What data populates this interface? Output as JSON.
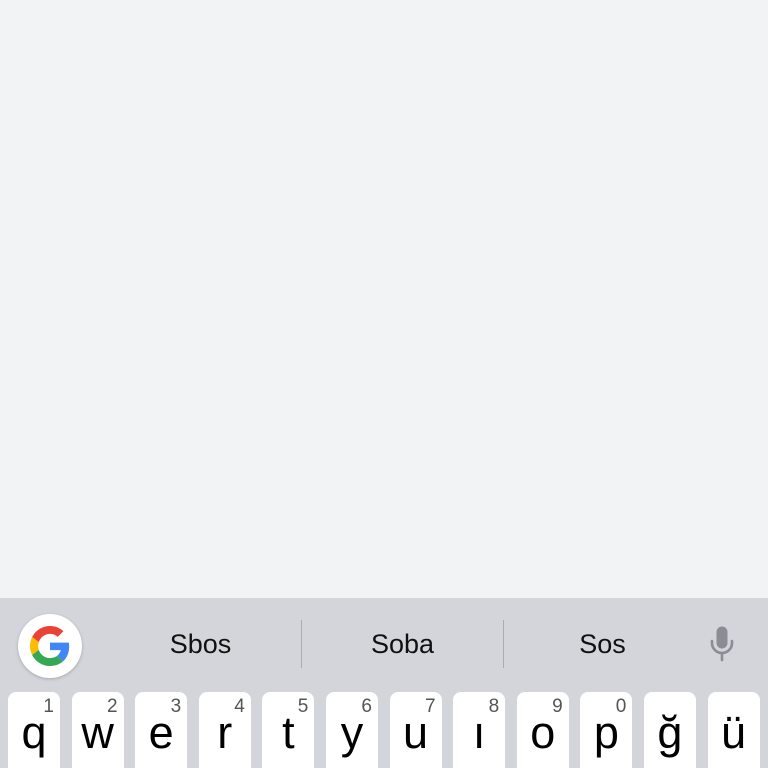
{
  "colors": {
    "background": "#f2f3f5",
    "keyboard": "#d3d5da",
    "key": "#ffffff",
    "mic": "#8a8d93",
    "google_red": "#EA4335",
    "google_blue": "#4285F4",
    "google_yellow": "#FBBC05",
    "google_green": "#34A853"
  },
  "suggestion_bar": {
    "google_icon": "google-g-icon",
    "suggestions": [
      "Sbos",
      "Soba",
      "Sos"
    ],
    "mic_icon": "microphone-icon"
  },
  "keyboard": {
    "keys": [
      {
        "letter": "q",
        "hint": "1"
      },
      {
        "letter": "w",
        "hint": "2"
      },
      {
        "letter": "e",
        "hint": "3"
      },
      {
        "letter": "r",
        "hint": "4"
      },
      {
        "letter": "t",
        "hint": "5"
      },
      {
        "letter": "y",
        "hint": "6"
      },
      {
        "letter": "u",
        "hint": "7"
      },
      {
        "letter": "ı",
        "hint": "8"
      },
      {
        "letter": "o",
        "hint": "9"
      },
      {
        "letter": "p",
        "hint": "0"
      },
      {
        "letter": "ğ"
      },
      {
        "letter": "ü"
      }
    ]
  }
}
